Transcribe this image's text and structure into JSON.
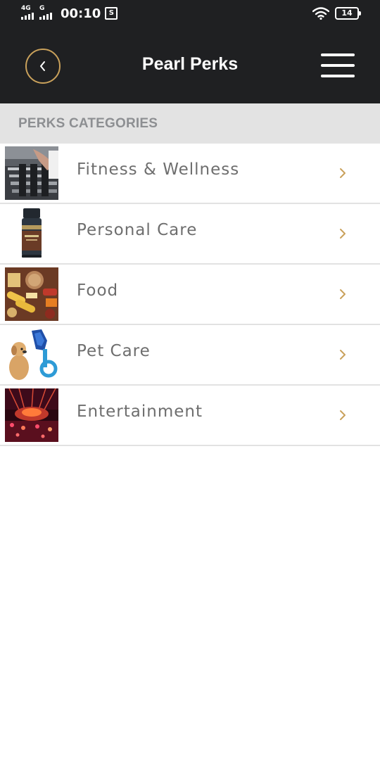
{
  "status_bar": {
    "network_1": "4G",
    "network_2": "G",
    "time": "00:10",
    "app_icon": "S",
    "battery": "14"
  },
  "header": {
    "title": "Pearl Perks",
    "back_icon": "chevron-left-icon",
    "menu_icon": "hamburger-menu-icon"
  },
  "section": {
    "title": "PERKS CATEGORIES"
  },
  "categories": [
    {
      "label": "Fitness & Wellness"
    },
    {
      "label": "Personal Care"
    },
    {
      "label": "Food"
    },
    {
      "label": "Pet Care"
    },
    {
      "label": "Entertainment"
    }
  ],
  "colors": {
    "header_bg": "#1f2022",
    "accent": "#c9a15b",
    "section_bg": "#e3e3e3",
    "section_text": "#8d8f92",
    "item_text": "#6e6e6e",
    "divider": "#e2e2e2"
  }
}
